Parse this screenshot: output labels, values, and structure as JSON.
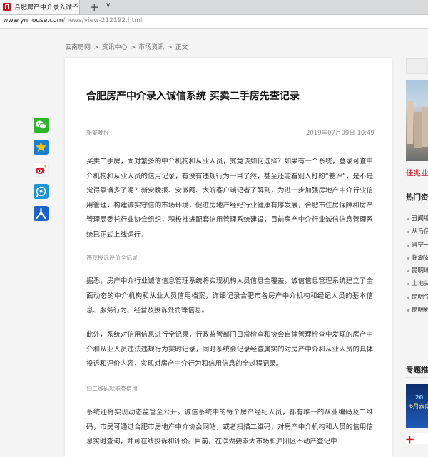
{
  "browser": {
    "tab_title": "合肥房产中介录入诚信",
    "tab_close": "✕",
    "new_tab": "+",
    "tab_menu": "∨",
    "url_host": "www.ynhouse.com",
    "url_path": "/news/view-212192.html"
  },
  "breadcrumb": [
    "云南房网",
    ">",
    "资讯中心",
    ">",
    "市场资讯",
    ">",
    "正文"
  ],
  "share_icons": [
    "wechat-icon",
    "qzone-icon",
    "weibo-icon",
    "tencent-weibo-icon",
    "renren-icon"
  ],
  "article": {
    "title": "合肥房产中介录入诚信系统 买卖二手房先查记录",
    "source": "新安晚报",
    "date": "2019年07月09日 10:49",
    "paragraphs": [
      "买卖二手房，面对繁多的中介机构和从业人员，究竟该如何选择？如果有一个系统，登录可查中介机构和从业人员的信用记录，有没有违规行为一目了然，甚至还能看别人打的“差评”，是不是觉得靠谱多了呢？新安晚报、安徽网、大皖客户端记者了解到，为进一步加强房地产中介行业信用管理，构建诚实守信的市场环境，促进房地产经纪行业健康有序发展，合肥市住房保障和房产管理局委托行业协会组织，积极推进配套信用管理系统建设，目前房产中介行业诚信信息管理系统已正式上线运行。",
      "据悉，房产中介行业诚信信息管理系统将实现机构人员信息全覆盖。诚信信息管理系统建立了全面动态的中介机构和从业人员信用档案，详细记录合肥市各房产中介机构和经纪人员的基本信息、服务行为、经营及投诉处罚等信息。",
      "此外，系统对信用信息进行全记录，行政监管部门日常检查和协会自律管理检查中发现的房产中介和从业人员违法违规行为实时记录，同时系统会记录经查属实的对房产中介和从业人员的具体投诉和评价内容，实现对房产中介行为和信用信息的全过程记录。",
      "系统还将实现动态监管全公开。诚信系统中的每个房产经纪人员，都有唯一的从业编码及二维码，市民可通过合肥市房地产中介协会网站，或者扫描二维码，对房产中介机构和人员的信用信息实时查询，并可在线投诉和评价。目前，在滨湖要素大市场和庐阳区不动产登记中"
    ],
    "subheads": [
      "违规投诉评价全记录",
      "扫二维码就能查信用"
    ]
  },
  "sidebar": {
    "caption": "佳兆业",
    "hot_title": "热门资",
    "hot_items": [
      "丑闻缠",
      "从马伊",
      "晋宁一",
      "临湖安",
      "昆明地",
      "土地尖",
      "昆明今",
      "昆明新"
    ],
    "topic_title": "专题推",
    "promo_text_1": "20",
    "promo_text_2": "6月云南",
    "promo_text_3": "十"
  },
  "colors": {
    "accent": "#c4161c",
    "wechat": "#2db52c",
    "qzone": "#f2b419",
    "weibo": "#e6162d",
    "tencent": "#1a93d8",
    "renren": "#1a63c9"
  }
}
